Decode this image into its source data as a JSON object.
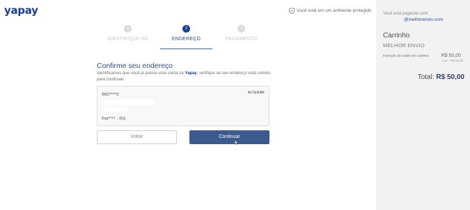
{
  "brand": {
    "logo_text": "yapay"
  },
  "secure_notice": "Você está em um ambiente protegido",
  "steps": [
    {
      "number": "1",
      "label": "IDENTIFIQUE-SE",
      "state": "inactive"
    },
    {
      "number": "2",
      "label": "ENDEREÇO",
      "state": "active"
    },
    {
      "number": "3",
      "label": "PAGAMENTO",
      "state": "inactive"
    }
  ],
  "confirm": {
    "title": "Confirme seu endereço",
    "desc_before": "Identificamos que você já possui uma conta na ",
    "desc_brand": "Yapay",
    "desc_after": ", verifique se seu endereço está correto para continuar."
  },
  "address": {
    "cep": "960****0",
    "city": "Pel**** - RS",
    "change_label": "ALTERAR"
  },
  "buttons": {
    "back": "Voltar",
    "continue": "Continuar"
  },
  "sidebar": {
    "paying_label": "Você está pagando com",
    "merchant": "@melhorenvio.com",
    "cart_title": "Carrinho",
    "carrier": "MELHOR ENVIO",
    "item": {
      "name": "Inserção de saldo em carteira",
      "price": "R$ 50,00",
      "qty": "1 un · R$ 50,00"
    },
    "total_label": "Total:",
    "total_value": "R$ 50,00"
  },
  "colors": {
    "brand": "#1b3f8f",
    "button_primary": "#3d5a8f",
    "sidebar_bg": "#f2f2f2"
  },
  "icons": {
    "secure": "shield-check-icon",
    "cursor": "mouse-pointer-icon"
  }
}
